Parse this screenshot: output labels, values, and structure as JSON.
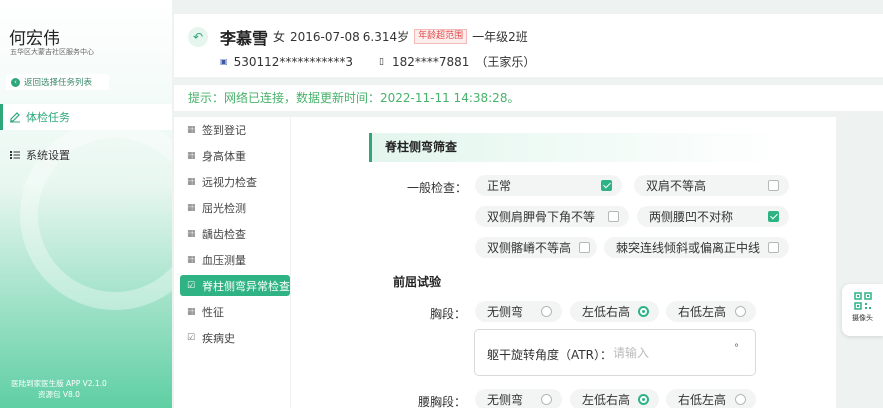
{
  "sidebar": {
    "user_name": "何宏伟",
    "org": "五华区大蒙吉社区服务中心",
    "back_label": "返回选择任务列表",
    "nav": [
      {
        "label": "体检任务",
        "icon": "edit-icon",
        "active": true
      },
      {
        "label": "系统设置",
        "icon": "list-settings-icon",
        "active": false
      }
    ],
    "app_version": "医陆到家医生版 APP V2.1.0",
    "resource_version": "资源包 V8.0"
  },
  "header": {
    "name": "李慕雪",
    "gender": "女",
    "birthdate": "2016-07-08",
    "age": "6.314岁",
    "age_badge": "年龄超范围",
    "class": "一年级2班",
    "id_number": "530112***********3",
    "phone": "182****7881",
    "guardian": "（王家乐）"
  },
  "notice": "提示：网络已连接，数据更新时间：2022-11-11  14:38:28。",
  "subnav": [
    {
      "label": "签到登记",
      "active": false
    },
    {
      "label": "身高体重",
      "active": false
    },
    {
      "label": "远视力检查",
      "active": false
    },
    {
      "label": "屈光检测",
      "active": false
    },
    {
      "label": "龋齿检查",
      "active": false
    },
    {
      "label": "血压测量",
      "active": false
    },
    {
      "label": "脊柱侧弯异常检查",
      "active": true
    },
    {
      "label": "性征",
      "active": false
    },
    {
      "label": "疾病史",
      "active": false
    }
  ],
  "main": {
    "section_title": "脊柱侧弯筛查",
    "general_label": "一般检查：",
    "general_options": [
      {
        "label": "正常",
        "checked": true
      },
      {
        "label": "双肩不等高",
        "checked": false
      },
      {
        "label": "双侧肩胛骨下角不等",
        "checked": false
      },
      {
        "label": "两侧腰凹不对称",
        "checked": true
      },
      {
        "label": "双侧髂嵴不等高",
        "checked": false
      },
      {
        "label": "棘突连线倾斜或偏离正中线",
        "checked": false
      }
    ],
    "forward_bend_title": "前屈试验",
    "chest_label": "胸段：",
    "chest_options": [
      {
        "label": "无侧弯",
        "selected": false
      },
      {
        "label": "左低右高",
        "selected": true
      },
      {
        "label": "右低左高",
        "selected": false
      }
    ],
    "atr_label": "躯干旋转角度（ATR）：",
    "atr_placeholder": "请输入",
    "atr_unit": "°",
    "lumbar_label": "腰胸段：",
    "lumbar_options": [
      {
        "label": "无侧弯",
        "selected": false
      },
      {
        "label": "左低右高",
        "selected": true
      },
      {
        "label": "右低左高",
        "selected": false
      }
    ]
  },
  "camera": {
    "label": "摄像头"
  },
  "colors": {
    "accent": "#2fb384",
    "notice": "#47b26a",
    "badge": "#e04a4a"
  }
}
